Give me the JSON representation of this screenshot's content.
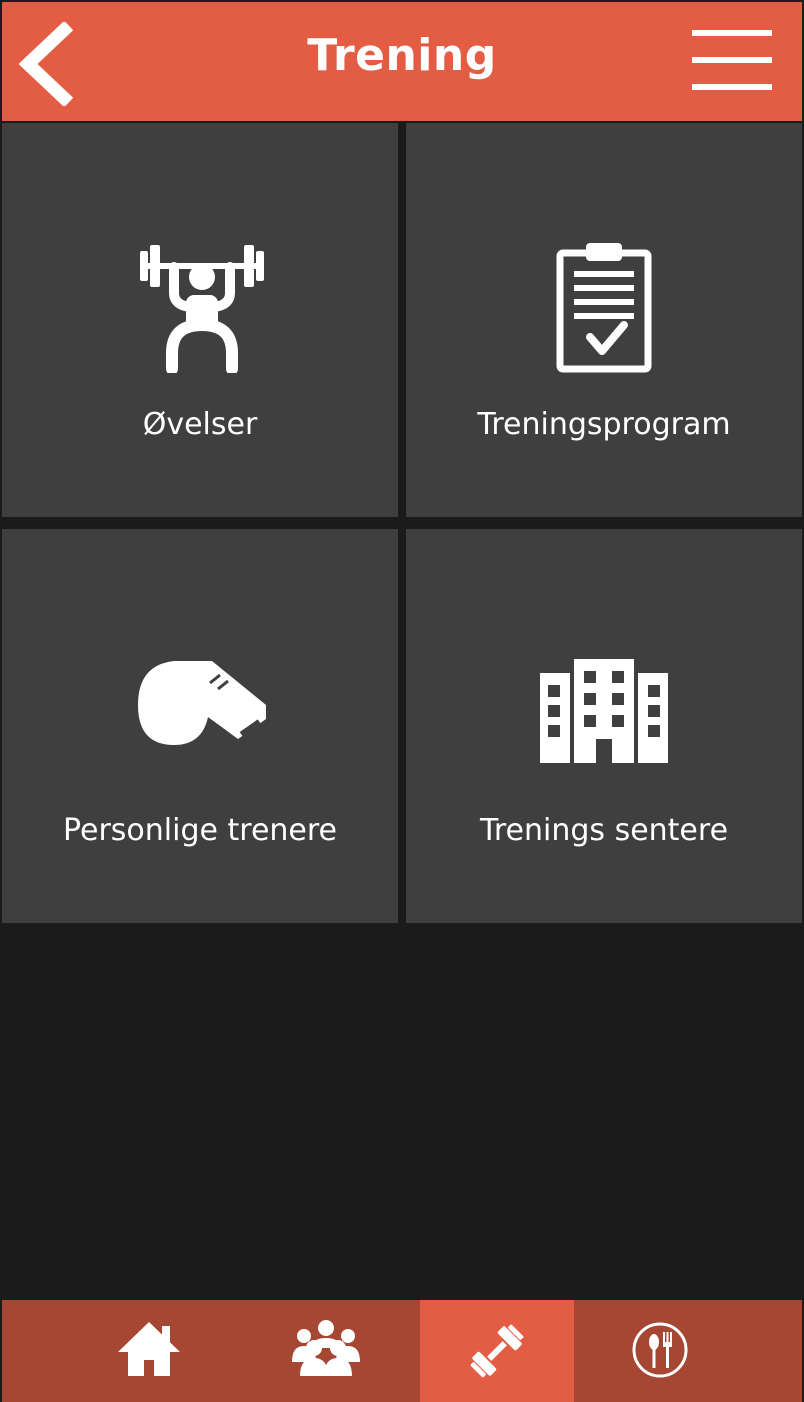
{
  "header": {
    "title": "Trening",
    "back_icon": "chevron-left-icon",
    "menu_icon": "hamburger-menu-icon"
  },
  "tiles": [
    {
      "label": "Øvelser",
      "icon": "weightlifter-icon"
    },
    {
      "label": "Treningsprogram",
      "icon": "clipboard-checklist-icon"
    },
    {
      "label": "Personlige trenere",
      "icon": "whistle-icon"
    },
    {
      "label": "Trenings sentere",
      "icon": "buildings-icon"
    }
  ],
  "bottom_nav": {
    "items": [
      {
        "icon": "home-icon",
        "active": false
      },
      {
        "icon": "group-icon",
        "active": false
      },
      {
        "icon": "dumbbell-icon",
        "active": true
      },
      {
        "icon": "restaurant-icon",
        "active": false
      }
    ]
  },
  "colors": {
    "accent": "#e35d45",
    "nav_background": "#a54733",
    "tile_background": "#3f3f3f",
    "background": "#1b1b1b"
  }
}
